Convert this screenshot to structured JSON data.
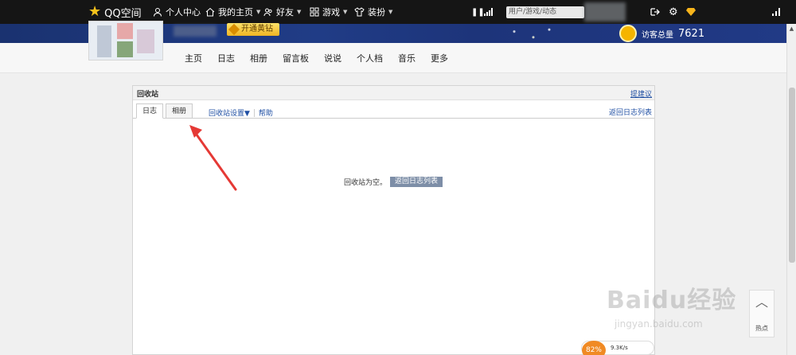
{
  "topbar": {
    "brand": "QQ空间",
    "items": [
      {
        "label": "个人中心"
      },
      {
        "label": "我的主页"
      },
      {
        "label": "好友"
      },
      {
        "label": "游戏"
      },
      {
        "label": "装扮"
      }
    ],
    "search_placeholder": "用户/游戏/动态"
  },
  "banner": {
    "vip_label": "开通黄钻",
    "visitors_label": "访客总量",
    "visitors_count": "7621"
  },
  "nav": {
    "links": [
      "主页",
      "日志",
      "相册",
      "留言板",
      "说说",
      "个人档",
      "音乐",
      "更多"
    ]
  },
  "recycle": {
    "title": "回收站",
    "suggest": "提建议",
    "tabs": [
      "日志",
      "相册"
    ],
    "settings": "回收站设置▼",
    "help": "帮助",
    "back_to_list": "返回日志列表",
    "empty_text": "回收站为空。",
    "empty_button": "返回日志列表"
  },
  "widgets": {
    "hot_label": "热点",
    "speed_percent": "82%",
    "speed_rate": "9.3K/s"
  },
  "watermark": {
    "brand": "Baidu经验",
    "url": "jingyan.baidu.com"
  },
  "colors": {
    "topbar": "#151515",
    "banner": "#203c86",
    "link": "#1f4fa3",
    "arrow": "#e53935"
  }
}
